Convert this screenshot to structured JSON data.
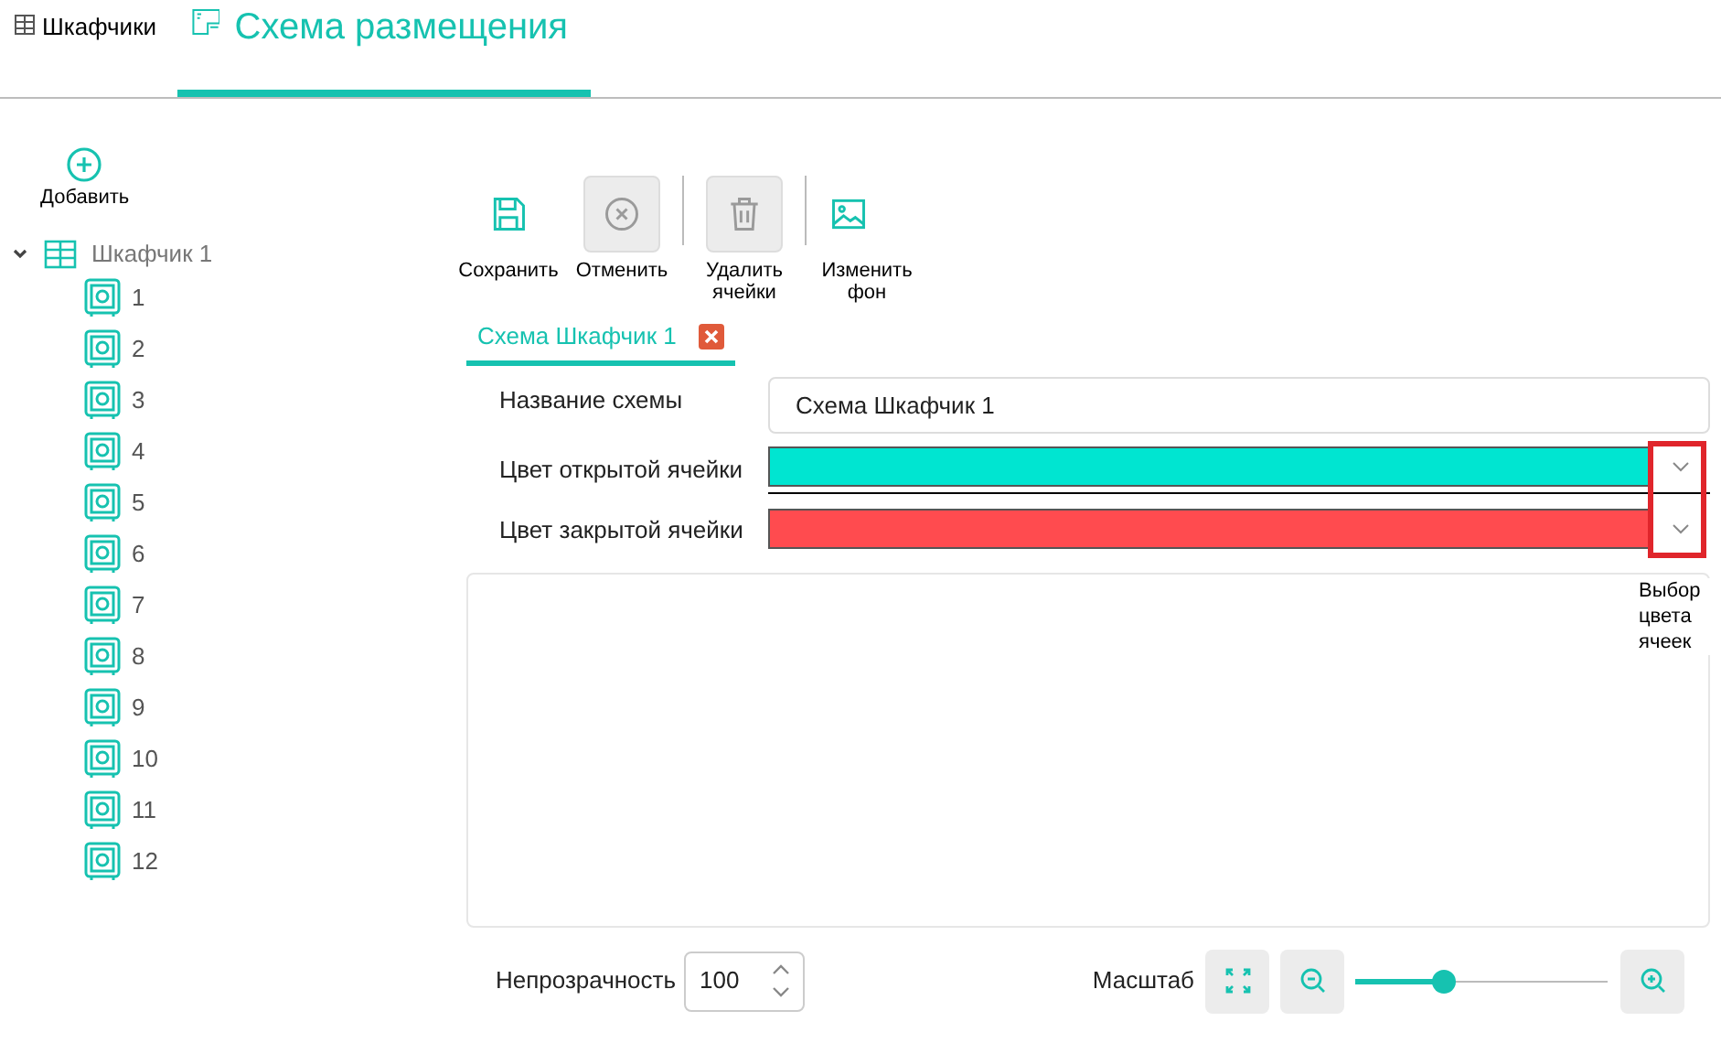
{
  "top_tabs": [
    {
      "label": "Шкафчики",
      "selected": false
    },
    {
      "label": "Схема размещения",
      "selected": true
    }
  ],
  "add_button": "Добавить",
  "tree": {
    "label": "Шкафчик 1",
    "expanded": true,
    "children": [
      {
        "label": "1"
      },
      {
        "label": "2"
      },
      {
        "label": "3"
      },
      {
        "label": "4"
      },
      {
        "label": "5"
      },
      {
        "label": "6"
      },
      {
        "label": "7"
      },
      {
        "label": "8"
      },
      {
        "label": "9"
      },
      {
        "label": "10"
      },
      {
        "label": "11"
      },
      {
        "label": "12"
      }
    ]
  },
  "toolbar": [
    {
      "kind": "save",
      "label": "Сохранить",
      "disabled": false
    },
    {
      "kind": "cancel",
      "label": "Отменить",
      "disabled": true
    },
    {
      "kind": "delete",
      "label": "Удалить ячейки",
      "disabled": true
    },
    {
      "kind": "background",
      "label": "Изменить фон",
      "disabled": false
    }
  ],
  "editor_tabs": [
    {
      "label": "Схема Шкафчик 1",
      "selected": true
    }
  ],
  "form": {
    "name_label": "Название схемы",
    "name_value": "Схема Шкафчик 1",
    "colors": [
      {
        "label": "Цвет открытой ячейки",
        "color": "#00e5d1"
      },
      {
        "label": "Цвет закрытой ячейки",
        "color": "#ff4b4f"
      }
    ],
    "callout": "Выбор цвета ячеек"
  },
  "opacity": {
    "label": "Непрозрачность",
    "value": "100"
  },
  "zoom": {
    "label": "Масштаб",
    "level": 0.35
  }
}
